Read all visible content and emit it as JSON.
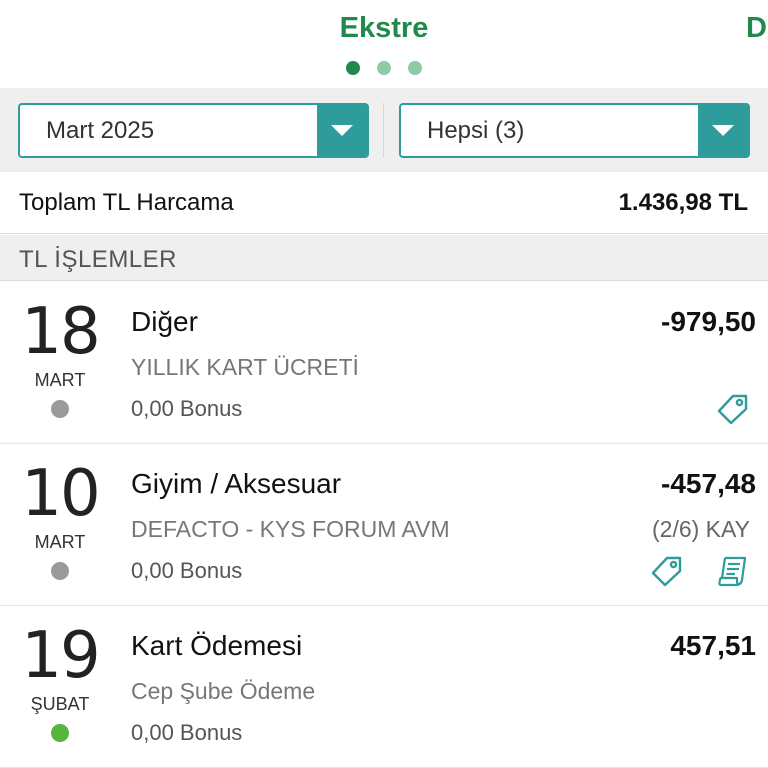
{
  "header": {
    "title": "Ekstre",
    "next_title": "D",
    "pages": 3,
    "active_page": 1
  },
  "filters": {
    "period": "Mart 2025",
    "card": "Hepsi (3)"
  },
  "total": {
    "label": "Toplam TL Harcama",
    "value": "1.436,98 TL"
  },
  "section": {
    "label": "TL İŞLEMLER"
  },
  "colors": {
    "accent_green": "#1f8a4c",
    "teal": "#2e9c9b",
    "status_gray": "#9a9a9a",
    "status_green": "#57b43f"
  },
  "transactions": [
    {
      "day": "18",
      "month": "MART",
      "status": "gray",
      "category": "Diğer",
      "merchant": "YILLIK KART ÜCRETİ",
      "bonus": "0,00 Bonus",
      "amount": "-979,50",
      "installment": "",
      "icons": [
        "tag-icon"
      ]
    },
    {
      "day": "10",
      "month": "MART",
      "status": "gray",
      "category": "Giyim / Aksesuar",
      "merchant": "DEFACTO - KYS FORUM AVM",
      "bonus": "0,00 Bonus",
      "amount": "-457,48",
      "installment": "(2/6) KAY",
      "icons": [
        "tag-icon",
        "receipt-icon"
      ]
    },
    {
      "day": "19",
      "month": "ŞUBAT",
      "status": "green",
      "category": "Kart Ödemesi",
      "merchant": "Cep Şube Ödeme",
      "bonus": "0,00 Bonus",
      "amount": "457,51",
      "installment": "",
      "icons": []
    }
  ]
}
